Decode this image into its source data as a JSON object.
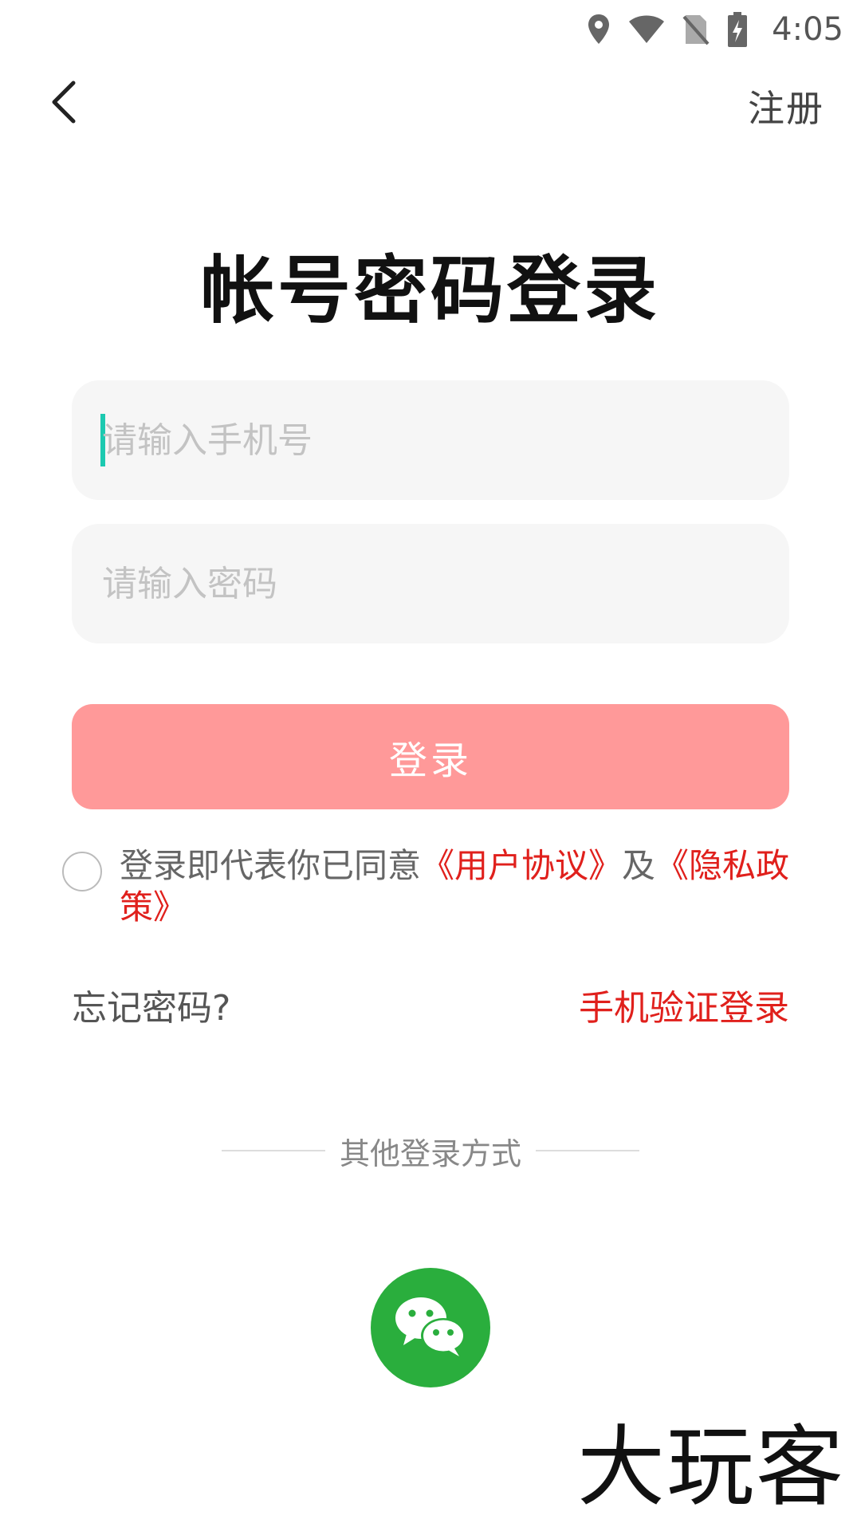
{
  "status_bar": {
    "time": "4:05",
    "icons": [
      "location-icon",
      "wifi-icon",
      "no-sim-icon",
      "battery-charging-icon"
    ]
  },
  "header": {
    "back_icon": "chevron-left-icon",
    "register_label": "注册"
  },
  "title": "帐号密码登录",
  "form": {
    "phone_placeholder": "请输入手机号",
    "phone_value": "",
    "password_placeholder": "请输入密码",
    "password_value": "",
    "login_label": "登录",
    "login_button_color": "#ff9999"
  },
  "agreement": {
    "checked": false,
    "prefix": "登录即代表你已同意",
    "user_agreement": "《用户协议》",
    "and": "及",
    "privacy_policy": "《隐私政策》",
    "link_color": "#e0201c"
  },
  "links": {
    "forgot_password": "忘记密码?",
    "sms_login": "手机验证登录"
  },
  "other_login": {
    "label": "其他登录方式",
    "methods": [
      {
        "name": "wechat",
        "icon": "wechat-icon",
        "color": "#2aae3d"
      }
    ]
  },
  "watermark": "大玩客",
  "colors": {
    "accent_red": "#e0201c",
    "cursor": "#1cc9b0",
    "field_bg": "#f6f6f6"
  }
}
